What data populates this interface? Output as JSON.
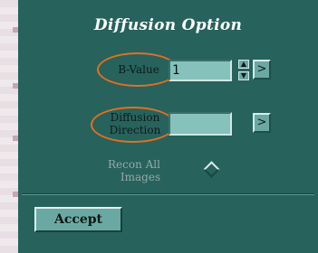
{
  "panel": {
    "title": "Diffusion Option",
    "bvalue": {
      "label": "B-Value",
      "value": "1",
      "spin_up": "▲",
      "spin_down": "▼",
      "arrow": ">"
    },
    "direction": {
      "label_line1": "Diffusion",
      "label_line2": "Direction",
      "value": "",
      "arrow": ">"
    },
    "reconall": {
      "label_line1": "Recon All",
      "label_line2": "Images"
    },
    "accept_label": "Accept"
  },
  "colors": {
    "panel_bg": "#27625d",
    "field_bg": "#86c1bb",
    "button_bg": "#6aa9a3",
    "highlight_oval": "#e46f1f",
    "title": "#ffffff"
  }
}
